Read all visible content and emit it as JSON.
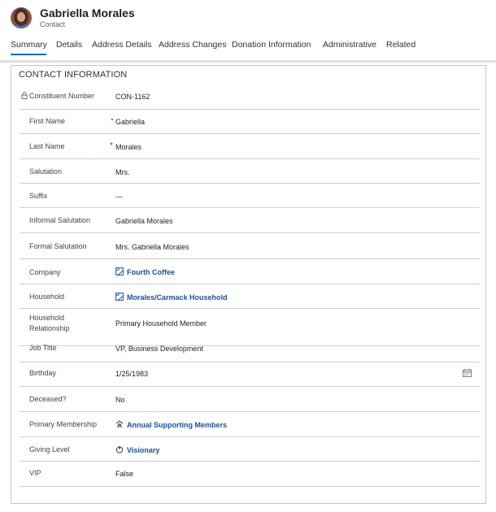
{
  "record": {
    "name": "Gabriella Morales",
    "entity": "Contact"
  },
  "tabs": [
    {
      "label": "Summary",
      "active": true
    },
    {
      "label": "Details"
    },
    {
      "label": "Address Details"
    },
    {
      "label": "Address Changes"
    },
    {
      "label": "Donation Information"
    },
    {
      "label": "Administrative"
    },
    {
      "label": "Related"
    }
  ],
  "section": {
    "title": "CONTACT INFORMATION"
  },
  "fields": {
    "constituent_number": {
      "label": "Constituent Number",
      "value": "CON-1162",
      "locked": true
    },
    "first_name": {
      "label": "First Name",
      "value": "Gabriella",
      "recommended": true
    },
    "last_name": {
      "label": "Last Name",
      "value": "Morales",
      "required_mark": "*"
    },
    "salutation": {
      "label": "Salutation",
      "value": "Mrs."
    },
    "suffix": {
      "label": "Suffix",
      "value": "---"
    },
    "informal_salutation": {
      "label": "Informal Salutation",
      "value": "Gabriella Morales"
    },
    "formal_salutation": {
      "label": "Formal Salutation",
      "value": "Mrs. Gabriella Morales"
    },
    "company": {
      "label": "Company",
      "value": "Fourth Coffee",
      "icon": "account-icon"
    },
    "household": {
      "label": "Household",
      "value": "Morales/Carmack Household",
      "icon": "account-icon"
    },
    "household_relationship": {
      "label": "Household Relationship",
      "value": "Primary Household Member"
    },
    "job_title": {
      "label": "Job Title",
      "value": "VP, Business Development"
    },
    "birthday": {
      "label": "Birthday",
      "value": "1/25/1983",
      "icon": "calendar-icon"
    },
    "deceased": {
      "label": "Deceased?",
      "value": "No"
    },
    "primary_membership": {
      "label": "Primary Membership",
      "value": "Annual Supporting Members",
      "icon": "membership-icon"
    },
    "giving_level": {
      "label": "Giving Level",
      "value": "Visionary",
      "icon": "giving-level-icon"
    },
    "vip": {
      "label": "VIP",
      "value": "False"
    }
  },
  "colors": {
    "link": "#1f4e9c",
    "required": "#a4262c",
    "accent": "#0f6cbd"
  }
}
